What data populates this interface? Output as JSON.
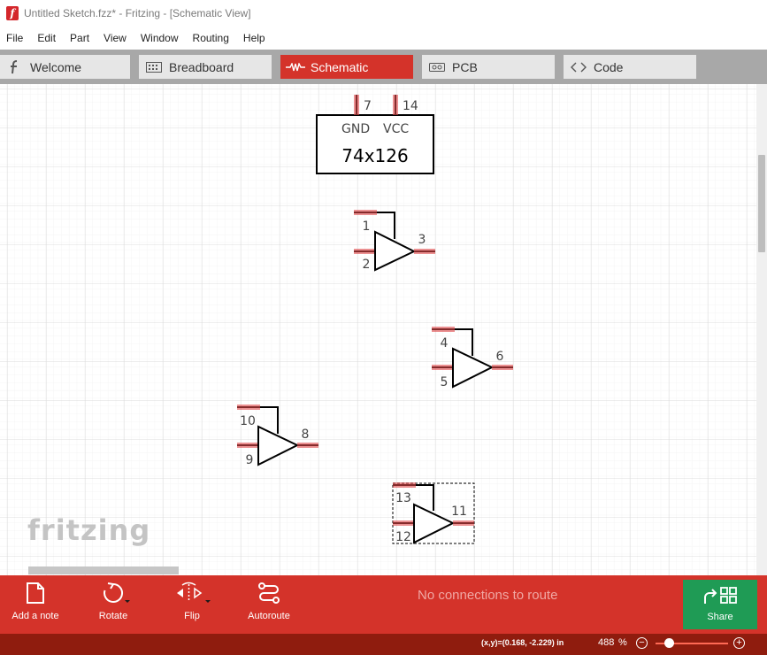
{
  "window": {
    "title": "Untitled Sketch.fzz* - Fritzing - [Schematic View]",
    "app_icon_letter": "f"
  },
  "menu": [
    "File",
    "Edit",
    "Part",
    "View",
    "Window",
    "Routing",
    "Help"
  ],
  "tabs": [
    {
      "label": "Welcome",
      "icon": "fritzing-f-icon",
      "active": false
    },
    {
      "label": "Breadboard",
      "icon": "breadboard-icon",
      "active": false
    },
    {
      "label": "Schematic",
      "icon": "resistor-icon",
      "active": true
    },
    {
      "label": "PCB",
      "icon": "pcb-icon",
      "active": false
    },
    {
      "label": "Code",
      "icon": "code-icon",
      "active": false
    }
  ],
  "schematic": {
    "ic_header": {
      "name": "74x126",
      "pin_labels": [
        "GND",
        "VCC"
      ],
      "pin_numbers": [
        "7",
        "14"
      ]
    },
    "buffers": [
      {
        "enable_pin": "1",
        "input_pin": "2",
        "output_pin": "3",
        "selected": false
      },
      {
        "enable_pin": "4",
        "input_pin": "5",
        "output_pin": "6",
        "selected": false
      },
      {
        "enable_pin": "10",
        "input_pin": "9",
        "output_pin": "8",
        "selected": false
      },
      {
        "enable_pin": "13",
        "input_pin": "12",
        "output_pin": "11",
        "selected": true
      }
    ],
    "watermark": "fritzing"
  },
  "toolbar": {
    "add_note": "Add a note",
    "rotate": "Rotate",
    "flip": "Flip",
    "autoroute": "Autoroute",
    "routing_status": "No connections to route",
    "share": "Share"
  },
  "statusbar": {
    "coordinates": "(x,y)=(0.168, -2.229) in",
    "zoom": "488",
    "zoom_unit": "%"
  },
  "colors": {
    "accent": "#d4332a",
    "statusbar": "#8f1c0e",
    "share": "#1f9b55",
    "pin": "#e0484a"
  }
}
